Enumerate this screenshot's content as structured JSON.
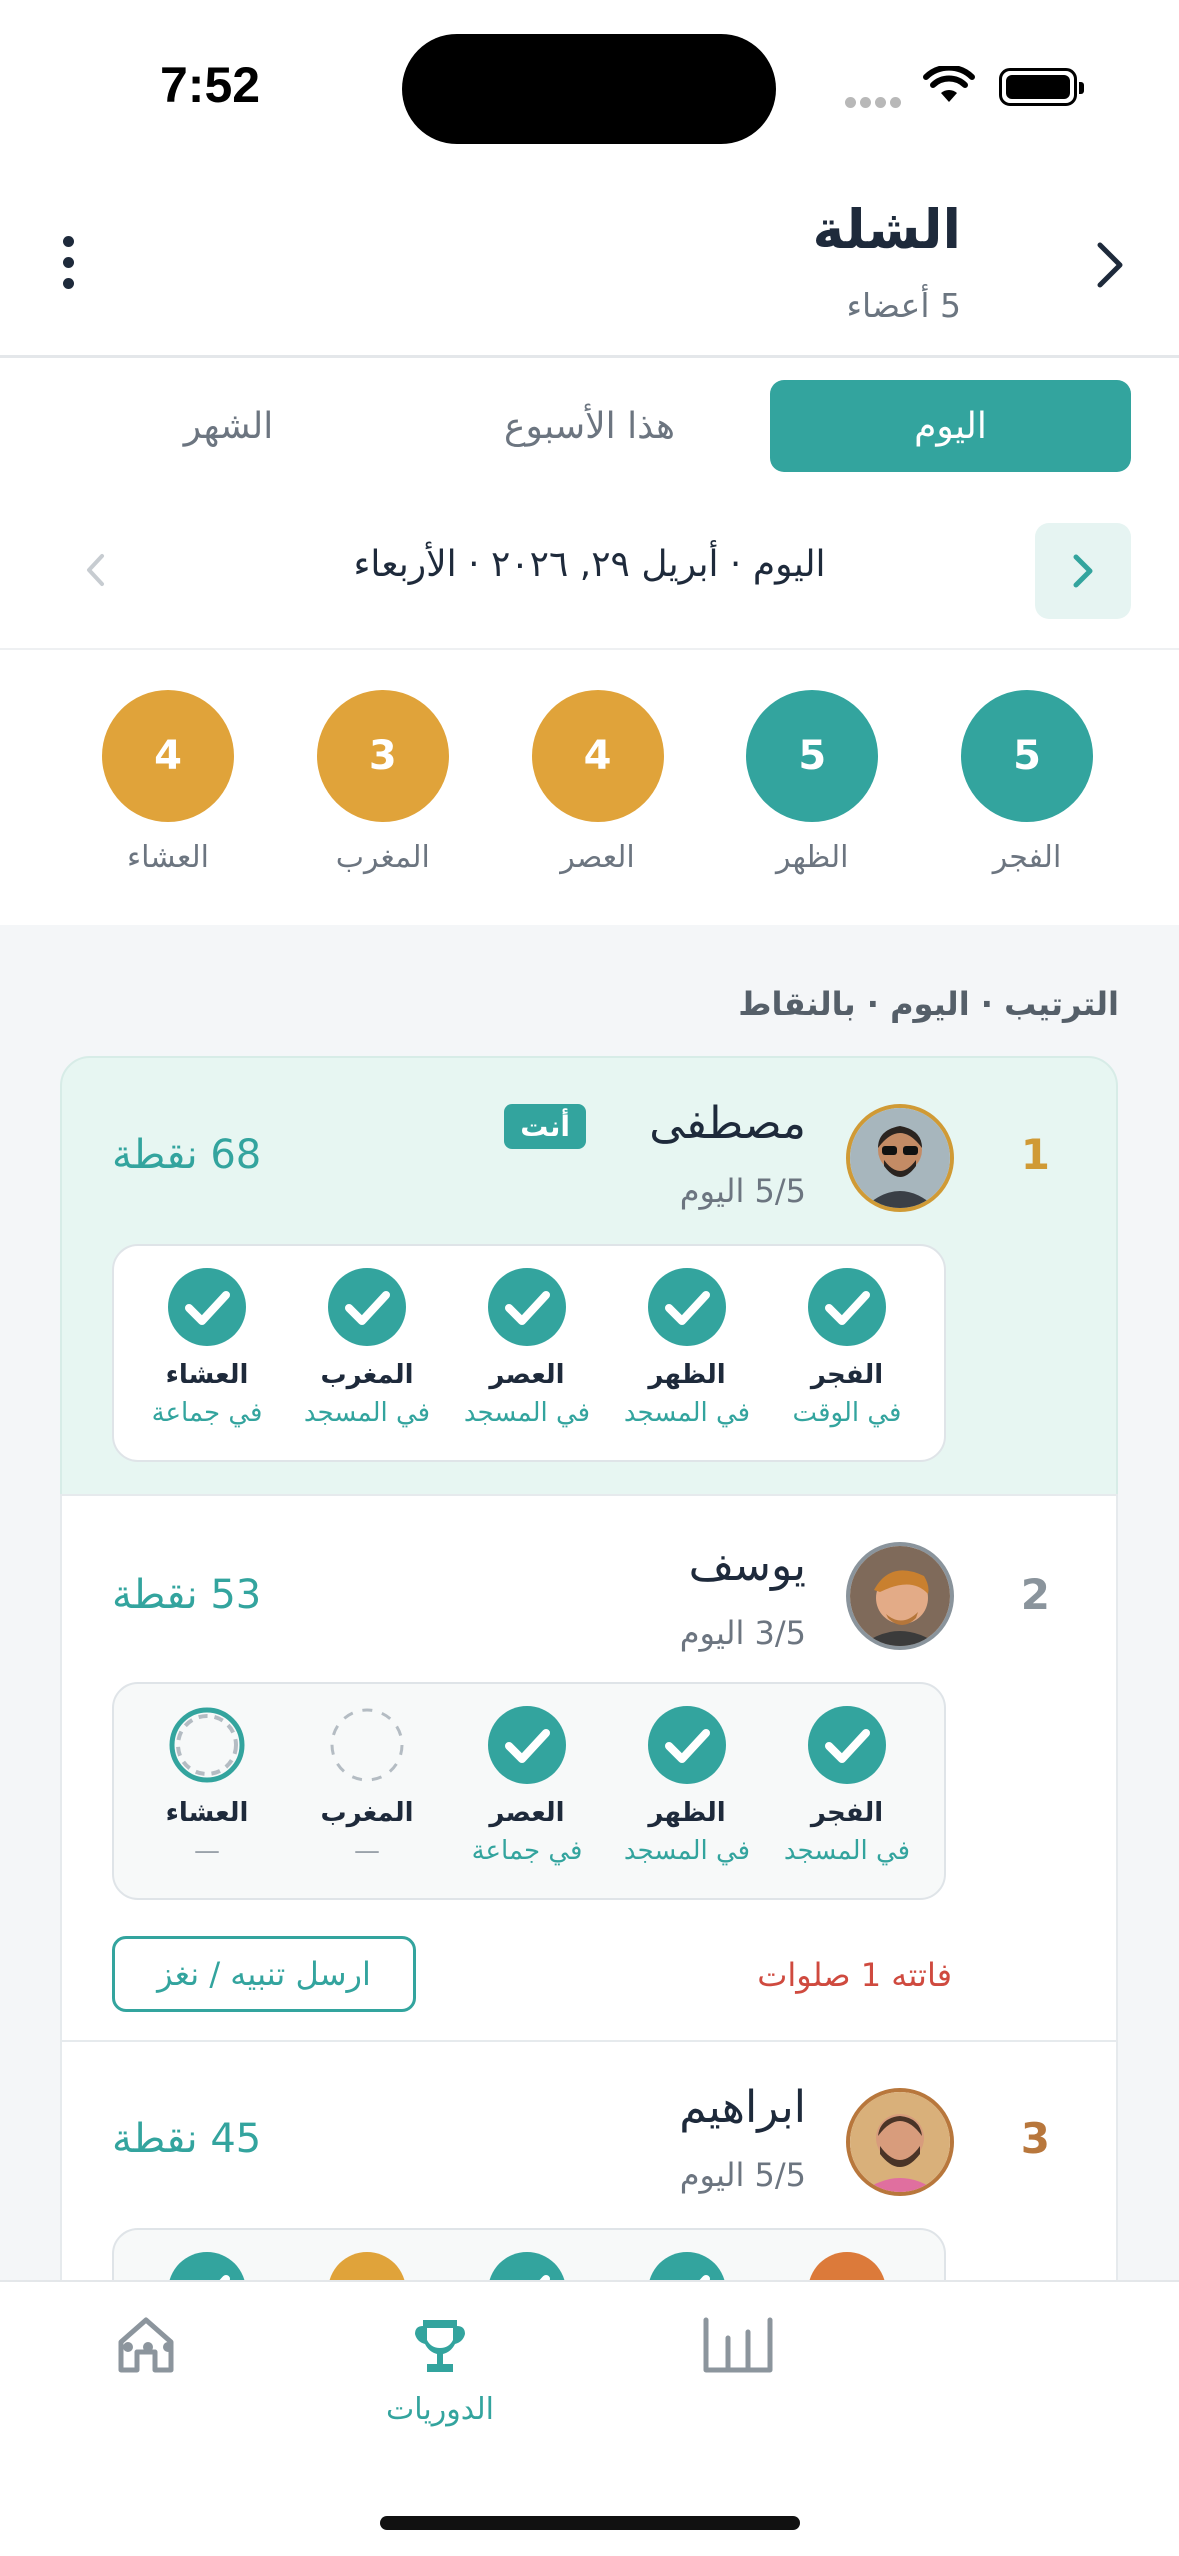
{
  "status_bar": {
    "time": "7:52"
  },
  "header": {
    "title": "الشلة",
    "subtitle": "5 أعضاء"
  },
  "tabs": [
    {
      "label": "اليوم",
      "active": true
    },
    {
      "label": "هذا الأسبوع",
      "active": false
    },
    {
      "label": "الشهر",
      "active": false
    }
  ],
  "date_label": "اليوم · أبريل ٢٩, ٢٠٢٦ · الأربعاء",
  "summary": [
    {
      "label": "الفجر",
      "count": "5",
      "color": "#33a49e"
    },
    {
      "label": "الظهر",
      "count": "5",
      "color": "#33a49e"
    },
    {
      "label": "العصر",
      "count": "4",
      "color": "#e0a33a"
    },
    {
      "label": "المغرب",
      "count": "3",
      "color": "#e0a33a"
    },
    {
      "label": "العشاء",
      "count": "4",
      "color": "#e0a33a"
    }
  ],
  "board_heading": "الترتيب · اليوم · بالنقاط",
  "members": [
    {
      "rank": "1",
      "name": "مصطفى",
      "you_badge": "أنت",
      "today": "5/5 اليوم",
      "points": "68 نقطة",
      "prayers": [
        {
          "name": "الفجر",
          "status": "في الوقت",
          "state": "done"
        },
        {
          "name": "الظهر",
          "status": "في المسجد",
          "state": "done"
        },
        {
          "name": "العصر",
          "status": "في المسجد",
          "state": "done"
        },
        {
          "name": "المغرب",
          "status": "في المسجد",
          "state": "done"
        },
        {
          "name": "العشاء",
          "status": "في جماعة",
          "state": "done"
        }
      ]
    },
    {
      "rank": "2",
      "name": "يوسف",
      "today": "3/5 اليوم",
      "points": "53 نقطة",
      "prayers": [
        {
          "name": "الفجر",
          "status": "في المسجد",
          "state": "done"
        },
        {
          "name": "الظهر",
          "status": "في المسجد",
          "state": "done"
        },
        {
          "name": "العصر",
          "status": "في جماعة",
          "state": "done"
        },
        {
          "name": "المغرب",
          "status": "—",
          "state": "missed"
        },
        {
          "name": "العشاء",
          "status": "—",
          "state": "pending"
        }
      ],
      "missed_text": "فاتته 1 صلوات",
      "nudge_label": "ارسل تنبيه / نغز"
    },
    {
      "rank": "3",
      "name": "ابراهيم",
      "today": "5/5 اليوم",
      "points": "45 نقطة"
    }
  ],
  "bottom_nav": {
    "active_label": "الدوريات"
  },
  "colors": {
    "accent": "#33a49e",
    "gold": "#e0a33a",
    "bronze": "#b8773c",
    "danger": "#cf4a3f"
  }
}
